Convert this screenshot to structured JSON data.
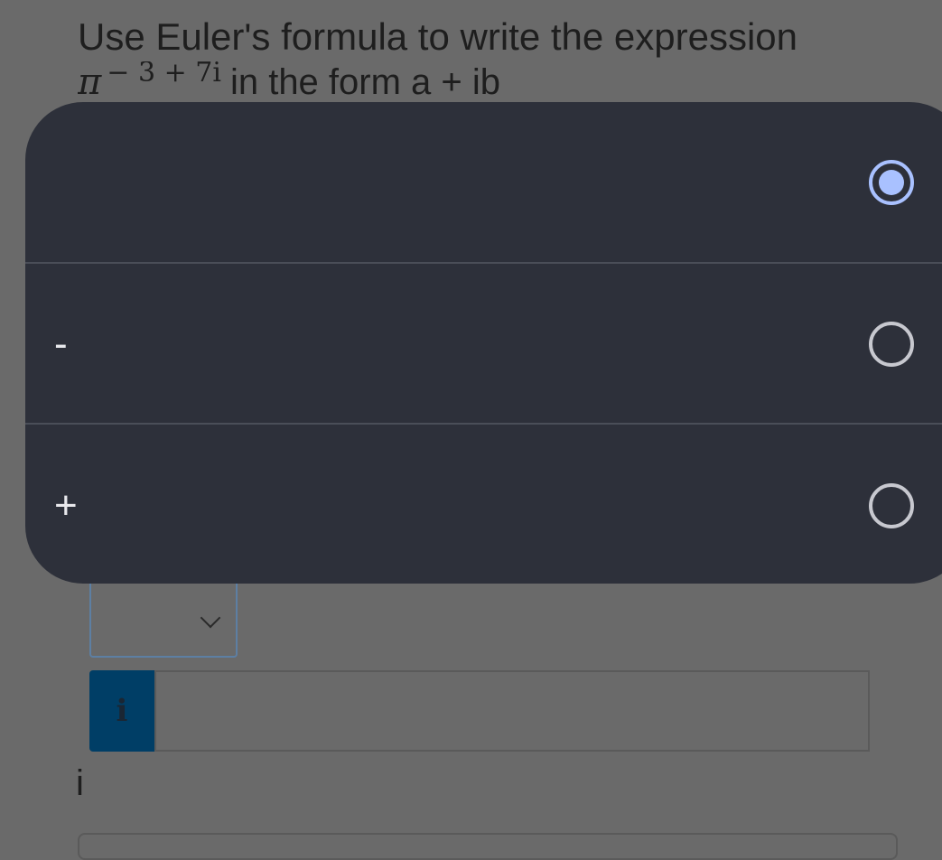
{
  "question": {
    "text": "Use Euler's formula to write the expression",
    "base": "π",
    "exponent": "− 3 + 7i",
    "suffix": "in the form a + ib"
  },
  "picker": {
    "options": [
      {
        "label": "",
        "selected": true
      },
      {
        "label": "-",
        "selected": false
      },
      {
        "label": "+",
        "selected": false
      }
    ]
  },
  "answer": {
    "info_button": "i",
    "input_value": "",
    "imag_unit_label": "i"
  },
  "colors": {
    "sheet_bg": "#2d303a",
    "selected_accent": "#a9c1ff",
    "info_button_bg": "#003e66"
  }
}
